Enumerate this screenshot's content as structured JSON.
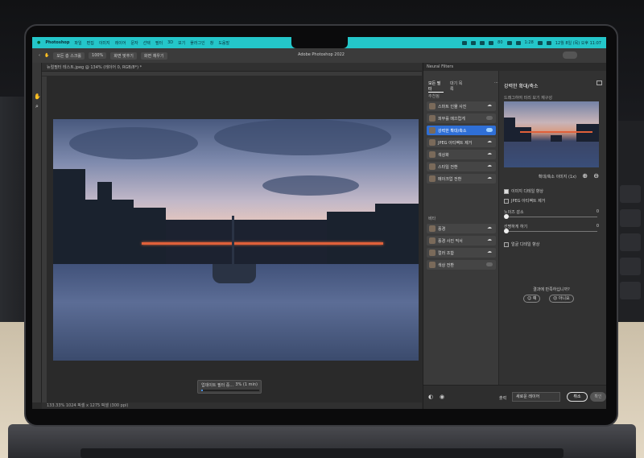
{
  "menubar": {
    "app": "Photoshop",
    "items": [
      "파일",
      "편집",
      "이미지",
      "레이어",
      "문자",
      "선택",
      "필터",
      "3D",
      "보기",
      "플러그인",
      "창",
      "도움말"
    ],
    "battery": "80",
    "time_short": "1:28",
    "datetime": "12월 8일 (목) 오후 11:07"
  },
  "optbar": {
    "pill1": "모든 층 스크롤",
    "zoom": "100%",
    "fit1": "화면 맞추기",
    "fit2": "화면 채우기",
    "title": "Adobe Photoshop 2022"
  },
  "document": {
    "tab": "뉴럴필터 테스트.jpeg @ 134% (레이어 0, RGB/8*) *",
    "status": "133.33%   1024 픽셀 x 1275 픽셀 (300 ppi)",
    "progress_label": "업데이트 필터 중...",
    "progress_pct": "3% (1 min)",
    "progress_value": 0.03
  },
  "neural": {
    "panel_title": "Neural Filters",
    "tabs": {
      "all": "모든 필터",
      "waitlist": "대기 목록"
    },
    "section_featured": "추천됨",
    "section_beta": "베타",
    "featured": [
      {
        "label": "스마트 인물 사진",
        "state": "cloud"
      },
      {
        "label": "피부를 매끄럽게",
        "state": "toggle"
      },
      {
        "label": "강력한 확대/축소",
        "state": "toggle-on"
      },
      {
        "label": "JPEG 아티팩트 제거",
        "state": "cloud"
      },
      {
        "label": "색상화",
        "state": "cloud"
      },
      {
        "label": "스타일 전환",
        "state": "cloud"
      },
      {
        "label": "메이크업 전환",
        "state": "cloud"
      }
    ],
    "beta": [
      {
        "label": "풍경",
        "state": "cloud"
      },
      {
        "label": "풍경 사진 믹서",
        "state": "cloud"
      },
      {
        "label": "컬러 조합",
        "state": "cloud"
      },
      {
        "label": "색상 전환",
        "state": "toggle"
      }
    ],
    "detail": {
      "title": "강력한 확대/축소",
      "preview_label": "드래그하여 미리 보기 재구성",
      "zoom_label": "확대/축소 이미지 (1x)",
      "check_enhance": "이미지 디테일 향상",
      "check_jpeg": "JPEG 아티팩트 제거",
      "slider_noise_label": "노이즈 감소",
      "slider_noise_value": "0",
      "slider_sharpen_label": "선명하게 하기",
      "slider_sharpen_value": "0",
      "check_face": "얼굴 디테일 향상",
      "feedback_q": "결과에 만족하십니까?",
      "feedback_yes": "예",
      "feedback_no": "아니요"
    },
    "footer": {
      "output_label": "출력",
      "output_value": "새로운 레이어",
      "cancel": "취소",
      "ok": "확인"
    }
  }
}
